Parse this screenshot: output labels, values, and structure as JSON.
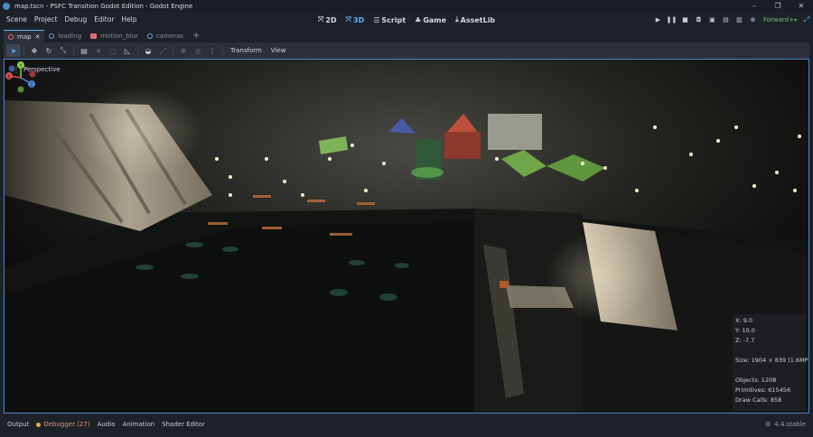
{
  "window": {
    "title": "map.tscn - PSFC Transition Godot Edition - Godot Engine",
    "controls": [
      "–",
      "❐",
      "✕"
    ]
  },
  "menu": [
    "Scene",
    "Project",
    "Debug",
    "Editor",
    "Help"
  ],
  "main_screens": [
    {
      "label": "2D",
      "icon": "2d-icon",
      "glyph": "⤧",
      "active": false
    },
    {
      "label": "3D",
      "icon": "3d-icon",
      "glyph": "⤧",
      "active": true
    },
    {
      "label": "Script",
      "icon": "script-icon",
      "glyph": "☰",
      "active": false
    },
    {
      "label": "Game",
      "icon": "game-icon",
      "glyph": "♣",
      "active": false
    },
    {
      "label": "AssetLib",
      "icon": "assetlib-icon",
      "glyph": "⤓",
      "active": false
    }
  ],
  "renderer": "Forward+",
  "tabs": [
    {
      "label": "map",
      "active": true,
      "icon": "dot-red"
    },
    {
      "label": "loading",
      "active": false,
      "icon": "dot"
    },
    {
      "label": "motion_blur",
      "active": false,
      "icon": "film"
    },
    {
      "label": "cameras",
      "active": false,
      "icon": "dot"
    }
  ],
  "toolbar": {
    "transform_label": "Transform",
    "view_label": "View"
  },
  "viewport": {
    "perspective_label": "Perspective",
    "gizmo_axes": {
      "x": "#e04d4d",
      "y": "#8bd14a",
      "z": "#4d8ce0"
    }
  },
  "stats": {
    "x": "X: 9.0",
    "y": "Y: 10.0",
    "z": "Z: -7.7",
    "size": "Size: 1904 × 839 (1.6MP)",
    "objects": "Objects: 1208",
    "primitives": "Primitives: 615456",
    "draw_calls": "Draw Calls: 858"
  },
  "bottom_panel": {
    "output": "Output",
    "debugger": "Debugger (27)",
    "audio": "Audio",
    "animation": "Animation",
    "shader_editor": "Shader Editor",
    "version": "4.4.stable"
  },
  "colors": {
    "accent": "#5fb2ff",
    "renderer": "#6ec36e",
    "warning": "#e8927c"
  }
}
